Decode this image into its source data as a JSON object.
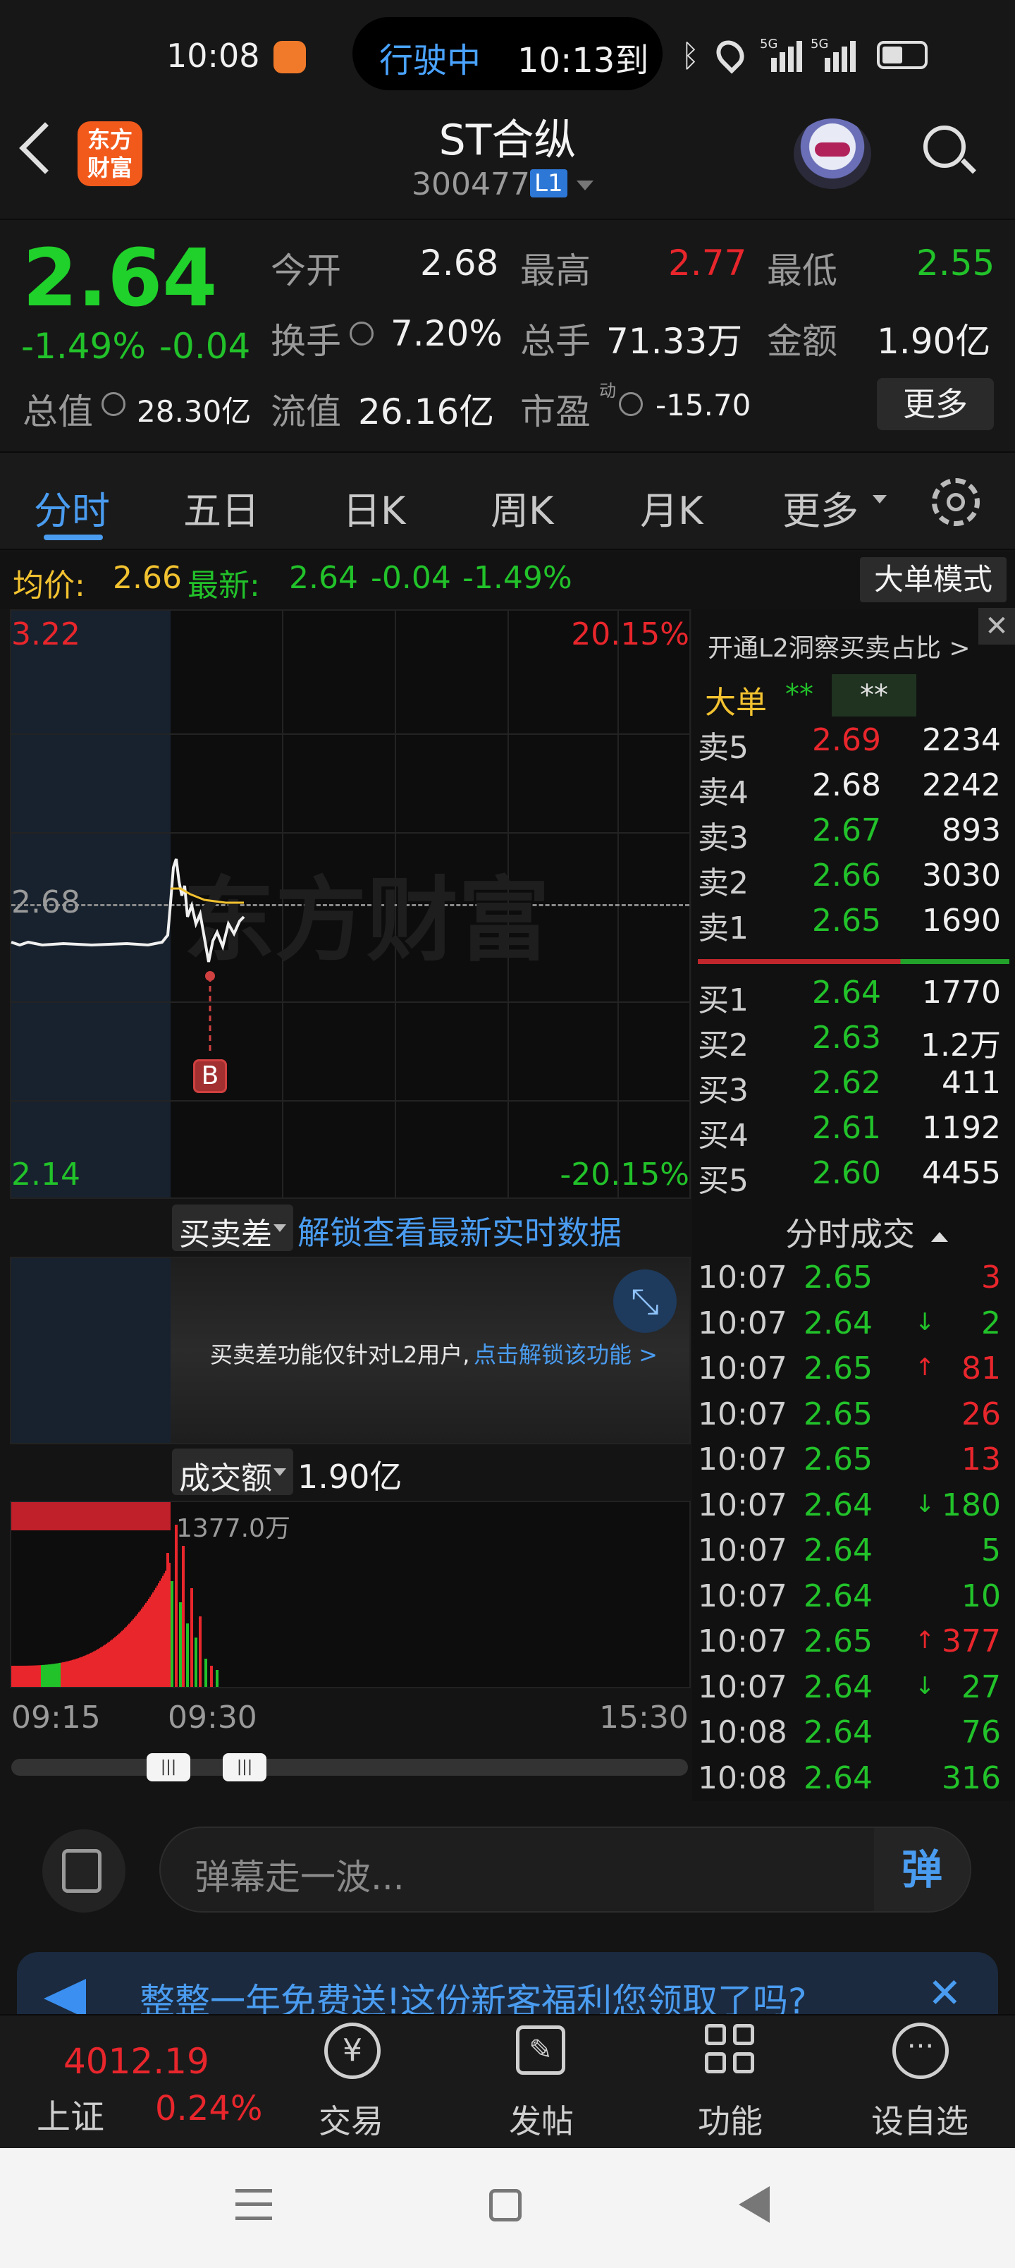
{
  "status": {
    "time": "10:08",
    "nav_state": "行驶中",
    "eta": "10:13到",
    "signal1": "5G",
    "signal2": "5G"
  },
  "header": {
    "logo_line1": "东方",
    "logo_line2": "财富",
    "stock_name": "ST合纵",
    "stock_code": "300477",
    "level_badge": "L1"
  },
  "quote": {
    "price": "2.64",
    "change_pct": "-1.49%",
    "change": "-0.04",
    "open_label": "今开",
    "open": "2.68",
    "high_label": "最高",
    "high": "2.77",
    "low_label": "最低",
    "low": "2.55",
    "turnover_label": "换手",
    "turnover": "7.20%",
    "volume_label": "总手",
    "volume": "71.33万",
    "amount_label": "金额",
    "amount": "1.90亿",
    "mktcap_label": "总值",
    "mktcap": "28.30亿",
    "float_label": "流值",
    "float": "26.16亿",
    "pe_label": "市盈",
    "pe_sup": "动",
    "pe": "-15.70",
    "more": "更多"
  },
  "tabs": [
    "分时",
    "五日",
    "日K",
    "周K",
    "月K",
    "更多"
  ],
  "avgline": {
    "avg_label": "均价:",
    "avg": "2.66",
    "latest_label": "最新:",
    "latest": "2.64",
    "chg": "-0.04",
    "chg_pct": "-1.49%",
    "mode_button": "大单模式"
  },
  "chart": {
    "y_top": "3.22",
    "y_mid": "2.68",
    "y_bottom": "2.14",
    "pct_top": "20.15%",
    "pct_bottom": "-20.15%",
    "watermark": "东方财富",
    "marker": "B",
    "sub1_select": "买卖差",
    "sub1_unlock": "解锁查看最新实时数据",
    "sub1_notice": "买卖差功能仅针对L2用户,",
    "sub1_link": "点击解锁该功能 >",
    "sub2_select": "成交额",
    "sub2_value": "1.90亿",
    "vol_max": "1377.0万",
    "x_start": "09:15",
    "x_mid": "09:30",
    "x_end": "15:30"
  },
  "book": {
    "promo": "开通L2洞察买卖占比 >",
    "big_label": "大单",
    "big_val1": "**",
    "big_val2": "**",
    "asks": [
      {
        "label": "卖5",
        "price": "2.69",
        "vol": "2234",
        "color": "#e8262c"
      },
      {
        "label": "卖4",
        "price": "2.68",
        "vol": "2242",
        "color": "#f0f0f0"
      },
      {
        "label": "卖3",
        "price": "2.67",
        "vol": "893",
        "color": "#22c22a"
      },
      {
        "label": "卖2",
        "price": "2.66",
        "vol": "3030",
        "color": "#22c22a"
      },
      {
        "label": "卖1",
        "price": "2.65",
        "vol": "1690",
        "color": "#22c22a"
      }
    ],
    "bids": [
      {
        "label": "买1",
        "price": "2.64",
        "vol": "1770",
        "color": "#22c22a"
      },
      {
        "label": "买2",
        "price": "2.63",
        "vol": "1.2万",
        "color": "#22c22a"
      },
      {
        "label": "买3",
        "price": "2.62",
        "vol": "411",
        "color": "#22c22a"
      },
      {
        "label": "买4",
        "price": "2.61",
        "vol": "1192",
        "color": "#22c22a"
      },
      {
        "label": "买5",
        "price": "2.60",
        "vol": "4455",
        "color": "#22c22a"
      }
    ],
    "trades_title": "分时成交",
    "trades": [
      {
        "t": "10:07",
        "p": "2.65",
        "a": "",
        "v": "3",
        "vc": "#e8262c"
      },
      {
        "t": "10:07",
        "p": "2.64",
        "a": "↓",
        "v": "2",
        "vc": "#22c22a"
      },
      {
        "t": "10:07",
        "p": "2.65",
        "a": "↑",
        "v": "81",
        "vc": "#e8262c"
      },
      {
        "t": "10:07",
        "p": "2.65",
        "a": "",
        "v": "26",
        "vc": "#e8262c"
      },
      {
        "t": "10:07",
        "p": "2.65",
        "a": "",
        "v": "13",
        "vc": "#e8262c"
      },
      {
        "t": "10:07",
        "p": "2.64",
        "a": "↓",
        "v": "180",
        "vc": "#22c22a"
      },
      {
        "t": "10:07",
        "p": "2.64",
        "a": "",
        "v": "5",
        "vc": "#22c22a"
      },
      {
        "t": "10:07",
        "p": "2.64",
        "a": "",
        "v": "10",
        "vc": "#22c22a"
      },
      {
        "t": "10:07",
        "p": "2.65",
        "a": "↑",
        "v": "377",
        "vc": "#e8262c"
      },
      {
        "t": "10:07",
        "p": "2.64",
        "a": "↓",
        "v": "27",
        "vc": "#22c22a"
      },
      {
        "t": "10:08",
        "p": "2.64",
        "a": "",
        "v": "76",
        "vc": "#22c22a"
      },
      {
        "t": "10:08",
        "p": "2.64",
        "a": "",
        "v": "316",
        "vc": "#22c22a"
      }
    ]
  },
  "comment": {
    "placeholder": "弹幕走一波...",
    "danmu": "弹"
  },
  "banner": {
    "text": "整整一年免费送!这份新客福利您领取了吗?"
  },
  "bottom_nav": {
    "index_value": "4012.19",
    "index_name": "上证",
    "index_pct": "0.24%",
    "items": [
      "交易",
      "发帖",
      "功能",
      "设自选"
    ]
  }
}
